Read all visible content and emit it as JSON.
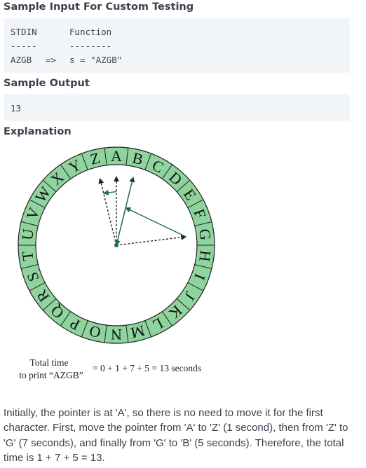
{
  "sample_input": {
    "heading": "Sample Input For Custom Testing",
    "col_stdin": "STDIN",
    "col_function": "Function",
    "dash_stdin": "-----",
    "dash_function": "--------",
    "stdin_value": "AZGB",
    "arrow": "=>",
    "function_value": "s = \"AZGB\""
  },
  "sample_output": {
    "heading": "Sample Output",
    "value": "13"
  },
  "explanation": {
    "heading": "Explanation",
    "figure": {
      "letters": [
        "A",
        "B",
        "C",
        "D",
        "E",
        "F",
        "G",
        "H",
        "I",
        "J",
        "K",
        "L",
        "M",
        "N",
        "O",
        "P",
        "Q",
        "R",
        "S",
        "T",
        "U",
        "V",
        "W",
        "X",
        "Y",
        "Z"
      ],
      "ring_color": "#8fd49e",
      "pointer_color": "#1e6b4a",
      "caption_line1": "Total time",
      "caption_line2": "to print “AZGB”",
      "equation": "= 0 + 1 + 7 + 5 = 13 seconds"
    },
    "paragraph": "Initially, the pointer is at 'A', so there is no need to move it for the first character. First, move the pointer from 'A' to 'Z' (1 second), then from 'Z' to 'G' (7 seconds), and finally from 'G' to 'B' (5 seconds). Therefore, the total time is 1 + 7 + 5 = 13."
  }
}
